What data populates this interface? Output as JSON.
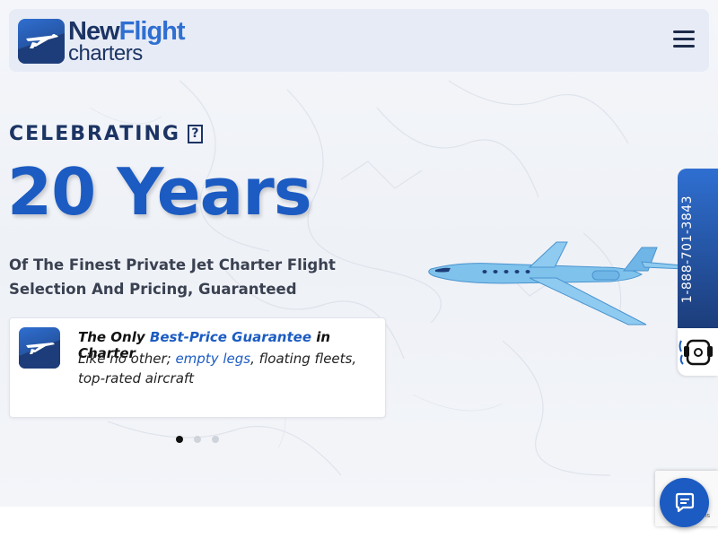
{
  "header": {
    "logo": {
      "word1": "New",
      "word2": "Flight",
      "word3": "charters"
    },
    "menu_icon": "hamburger-menu-icon"
  },
  "hero": {
    "eyebrow": "CELEBRATING",
    "eyebrow_glyph": "?",
    "headline": "20 Years",
    "subhead": "Of The Finest Private Jet Charter Flight Selection And Pricing, Guaranteed",
    "card": {
      "title_prefix": "The Only ",
      "title_accent": "Best-Price Guarantee",
      "title_suffix": " in Charter",
      "body_prefix": "Like no other; ",
      "body_link": "empty legs",
      "body_suffix": ", floating fleets, top-rated aircraft"
    },
    "carousel": {
      "slides": 3,
      "active_index": 0
    }
  },
  "phone_tab": {
    "number": "1-888-701-3843"
  },
  "recaptcha": {
    "text": "Terms"
  },
  "colors": {
    "brand_blue": "#1c5cc2",
    "navy": "#1c3463",
    "header_bg": "#e6ebf5",
    "jet_blue": "#7fc2ec"
  },
  "icons": {
    "logo": "plane-logo-icon",
    "card": "plane-badge-icon",
    "support": "headset-support-icon",
    "chat": "chat-bubble-icon",
    "recaptcha": "recaptcha-icon"
  }
}
